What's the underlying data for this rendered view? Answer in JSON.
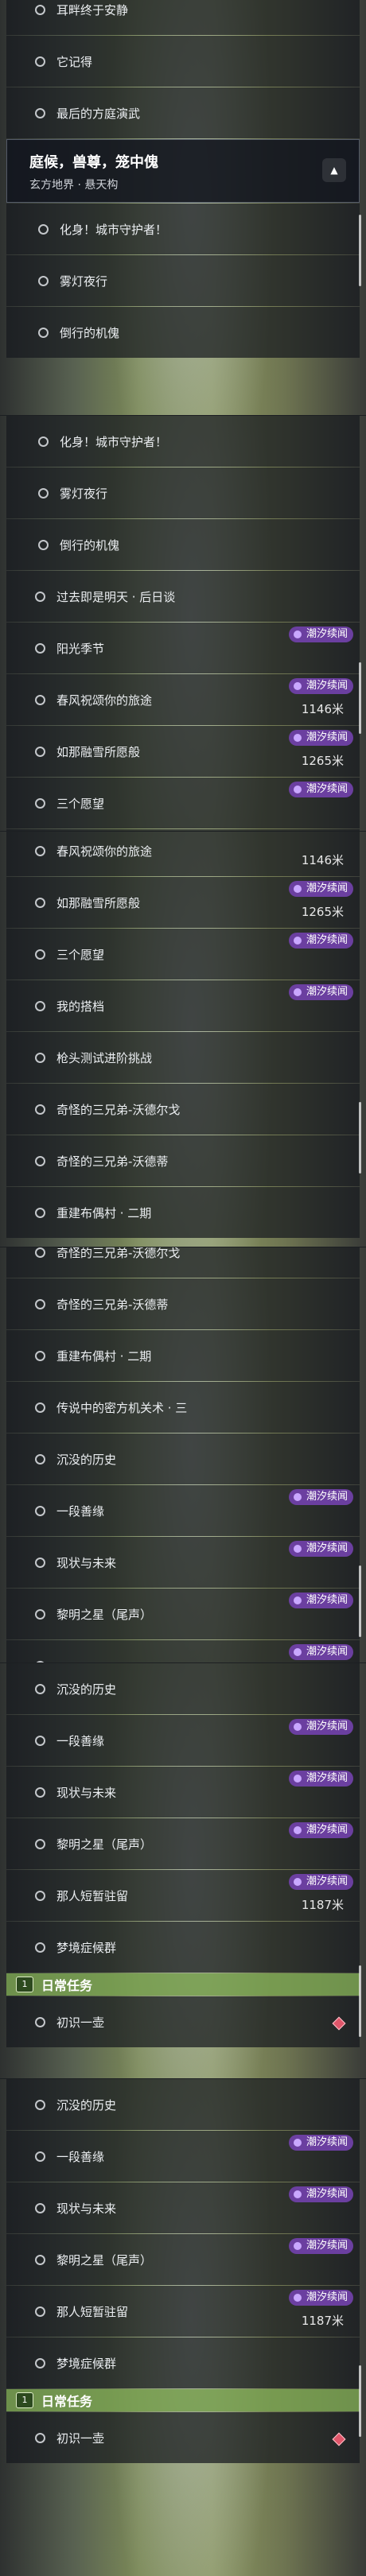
{
  "badge_label": "潮汐续闻",
  "header": {
    "title": "庭候，兽尊，笼中傀",
    "subtitle": "玄方地界 · 悬天构"
  },
  "section": {
    "daily_tasks": "日常任务",
    "icon": "calendar-book-icon"
  },
  "colors": {
    "badge": "#6b3fa0",
    "section": "#78a050",
    "marker": "#e0566a"
  },
  "panels": [
    {
      "rows": [
        {
          "label": "耳畔终于安静"
        },
        {
          "label": "它记得"
        },
        {
          "label": "最后的方庭演武"
        },
        {
          "header": true
        },
        {
          "label": "化身！城市守护者！",
          "sub": true
        },
        {
          "label": "雾灯夜行",
          "sub": true
        },
        {
          "label": "倒行的机傀",
          "sub": true
        }
      ]
    },
    {
      "rows": [
        {
          "label": "化身！城市守护者！",
          "sub": true
        },
        {
          "label": "雾灯夜行",
          "sub": true
        },
        {
          "label": "倒行的机傀",
          "sub": true
        },
        {
          "label": "过去即是明天 · 后日谈"
        },
        {
          "label": "阳光季节",
          "badge": true
        },
        {
          "label": "春风祝颂你的旅途",
          "badge": true,
          "dist": "1146米"
        },
        {
          "label": "如那融雪所愿般",
          "badge": true,
          "dist": "1265米"
        },
        {
          "label": "三个愿望",
          "badge": true
        },
        {
          "label": "",
          "badge": true
        }
      ]
    },
    {
      "rows": [
        {
          "label": "春风祝颂你的旅途",
          "dist": "1146米"
        },
        {
          "label": "如那融雪所愿般",
          "badge": true,
          "dist": "1265米"
        },
        {
          "label": "三个愿望",
          "badge": true
        },
        {
          "label": "我的搭档",
          "badge": true
        },
        {
          "label": "枪头测试进阶挑战"
        },
        {
          "label": "奇怪的三兄弟-沃德尔戈"
        },
        {
          "label": "奇怪的三兄弟-沃德蒂"
        },
        {
          "label": "重建布偶村 · 二期"
        }
      ]
    },
    {
      "rows": [
        {
          "label": "奇怪的三兄弟-沃德尔戈"
        },
        {
          "label": "奇怪的三兄弟-沃德蒂"
        },
        {
          "label": "重建布偶村 · 二期"
        },
        {
          "label": "传说中的密方机关术 · 三"
        },
        {
          "label": "沉没的历史"
        },
        {
          "label": "一段善缘",
          "badge": true
        },
        {
          "label": "现状与未来",
          "badge": true
        },
        {
          "label": "黎明之星（尾声）",
          "badge": true
        },
        {
          "label": "",
          "badge": true
        }
      ]
    },
    {
      "rows": [
        {
          "label": "沉没的历史"
        },
        {
          "label": "一段善缘",
          "badge": true
        },
        {
          "label": "现状与未来",
          "badge": true
        },
        {
          "label": "黎明之星（尾声）",
          "badge": true
        },
        {
          "label": "那人短暂驻留",
          "badge": true,
          "dist": "1187米"
        },
        {
          "label": "梦境症候群"
        },
        {
          "section": true
        },
        {
          "label": "初识一壶",
          "marker": true
        }
      ]
    },
    {
      "rows": [
        {
          "label": "沉没的历史"
        },
        {
          "label": "一段善缘",
          "badge": true
        },
        {
          "label": "现状与未来",
          "badge": true
        },
        {
          "label": "黎明之星（尾声）",
          "badge": true
        },
        {
          "label": "那人短暂驻留",
          "badge": true,
          "dist": "1187米"
        },
        {
          "label": "梦境症候群"
        },
        {
          "section": true
        },
        {
          "label": "初识一壶",
          "marker": true
        }
      ]
    }
  ]
}
